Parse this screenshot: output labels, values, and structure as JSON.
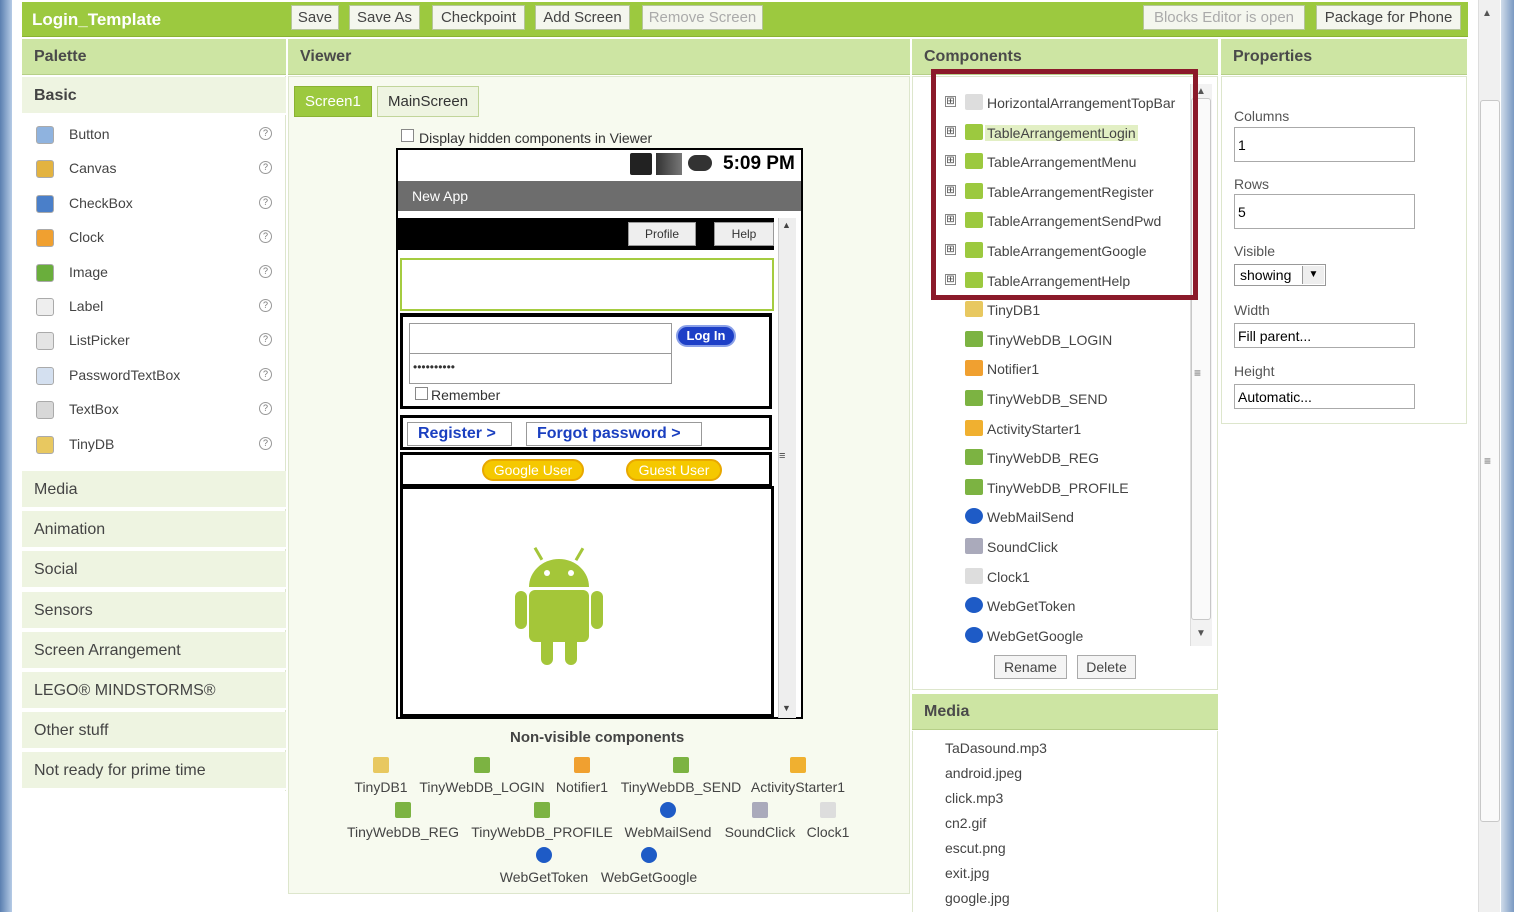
{
  "app": {
    "title": "Login_Template"
  },
  "toolbar": {
    "save": "Save",
    "save_as": "Save As",
    "checkpoint": "Checkpoint",
    "add_screen": "Add Screen",
    "remove_screen": "Remove Screen",
    "blocks_editor": "Blocks Editor is open",
    "package": "Package for Phone"
  },
  "palette": {
    "header": "Palette",
    "basic": "Basic",
    "items": [
      "Button",
      "Canvas",
      "CheckBox",
      "Clock",
      "Image",
      "Label",
      "ListPicker",
      "PasswordTextBox",
      "TextBox",
      "TinyDB"
    ],
    "categories": [
      "Media",
      "Animation",
      "Social",
      "Sensors",
      "Screen Arrangement",
      "LEGO® MINDSTORMS®",
      "Other stuff",
      "Not ready for prime time"
    ],
    "help": "?"
  },
  "viewer": {
    "header": "Viewer",
    "tabs": [
      "Screen1",
      "MainScreen"
    ],
    "display_hidden": "Display hidden components in Viewer",
    "status_time": "5:09 PM",
    "app_bar_title": "New App",
    "profile": "Profile",
    "help": "Help",
    "password_mask": "••••••••••",
    "login_button": "Log In",
    "remember": "Remember",
    "register": "Register >",
    "forgot": "Forgot password >",
    "google_user": "Google User",
    "guest_user": "Guest User",
    "non_visible_title": "Non-visible components",
    "non_visible": [
      "TinyDB1",
      "TinyWebDB_LOGIN",
      "Notifier1",
      "TinyWebDB_SEND",
      "ActivityStarter1",
      "TinyWebDB_REG",
      "TinyWebDB_PROFILE",
      "WebMailSend",
      "SoundClick",
      "Clock1",
      "WebGetToken",
      "WebGetGoogle"
    ]
  },
  "components": {
    "header": "Components",
    "items": [
      "HorizontalArrangementTopBar",
      "TableArrangementLogin",
      "TableArrangementMenu",
      "TableArrangementRegister",
      "TableArrangementSendPwd",
      "TableArrangementGoogle",
      "TableArrangementHelp",
      "TinyDB1",
      "TinyWebDB_LOGIN",
      "Notifier1",
      "TinyWebDB_SEND",
      "ActivityStarter1",
      "TinyWebDB_REG",
      "TinyWebDB_PROFILE",
      "WebMailSend",
      "SoundClick",
      "Clock1",
      "WebGetToken",
      "WebGetGoogle"
    ],
    "selected": "TableArrangementLogin",
    "expand": "⊞",
    "rename": "Rename",
    "delete": "Delete"
  },
  "properties": {
    "header": "Properties",
    "columns_label": "Columns",
    "columns_value": "1",
    "rows_label": "Rows",
    "rows_value": "5",
    "visible_label": "Visible",
    "visible_value": "showing",
    "width_label": "Width",
    "width_value": "Fill parent...",
    "height_label": "Height",
    "height_value": "Automatic..."
  },
  "media": {
    "header": "Media",
    "items": [
      "TaDasound.mp3",
      "android.jpeg",
      "click.mp3",
      "cn2.gif",
      "escut.png",
      "exit.jpg",
      "google.jpg"
    ]
  },
  "colors": {
    "accent": "#9cc93f",
    "highlight_box": "#8b1a2a",
    "link": "#1a3fc0",
    "yellow": "#f5c800"
  }
}
